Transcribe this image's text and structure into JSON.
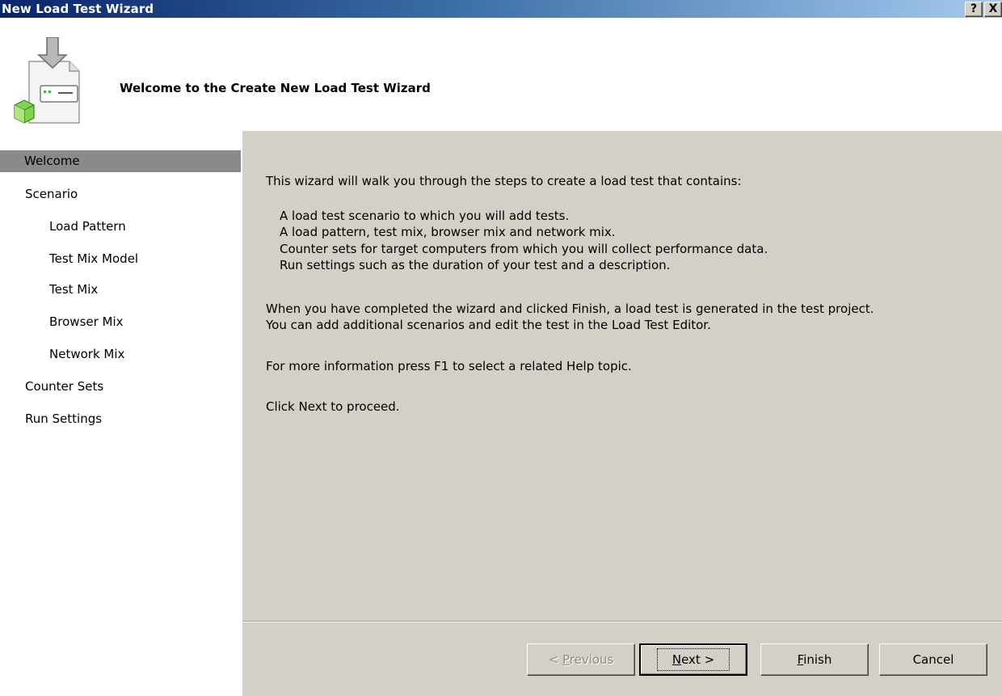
{
  "window": {
    "title": "New Load Test Wizard",
    "help_glyph": "?",
    "close_glyph": "X"
  },
  "header": {
    "heading": "Welcome to the Create New Load Test Wizard",
    "icon": "wizard-document-icon"
  },
  "sidebar": {
    "items": [
      {
        "label": "Welcome",
        "selected": true
      },
      {
        "label": "Scenario"
      },
      {
        "label": "Load Pattern"
      },
      {
        "label": "Test Mix Model"
      },
      {
        "label": "Test Mix"
      },
      {
        "label": "Browser Mix"
      },
      {
        "label": "Network Mix"
      },
      {
        "label": "Counter Sets"
      },
      {
        "label": "Run Settings"
      }
    ]
  },
  "content": {
    "intro": "This wizard will walk you through the steps to create a load test that contains:",
    "bullets": [
      "A load test scenario to which you will add tests.",
      "A load pattern, test mix, browser mix and network mix.",
      "Counter sets for target computers from which you will collect performance data.",
      "Run settings such as the duration of your test and a description."
    ],
    "finish_line1": "When you have completed the wizard and clicked Finish, a load test is generated in the test project.",
    "finish_line2": "You can add additional scenarios and edit the test in the Load Test Editor.",
    "help_line": "For more information press F1 to select a related Help topic.",
    "proceed_line": "Click Next to proceed."
  },
  "buttons": {
    "previous": {
      "prefix": "< ",
      "mnemonic": "P",
      "rest": "revious"
    },
    "next": {
      "mnemonic": "N",
      "rest": "ext >"
    },
    "finish": {
      "mnemonic": "F",
      "rest": "inish"
    },
    "cancel": "Cancel"
  },
  "colors": {
    "title_gradient_start": "#0a246a",
    "title_gradient_end": "#a6caf0",
    "dialog_face": "#d4d0c8",
    "selected_nav": "#8a8a8a"
  }
}
